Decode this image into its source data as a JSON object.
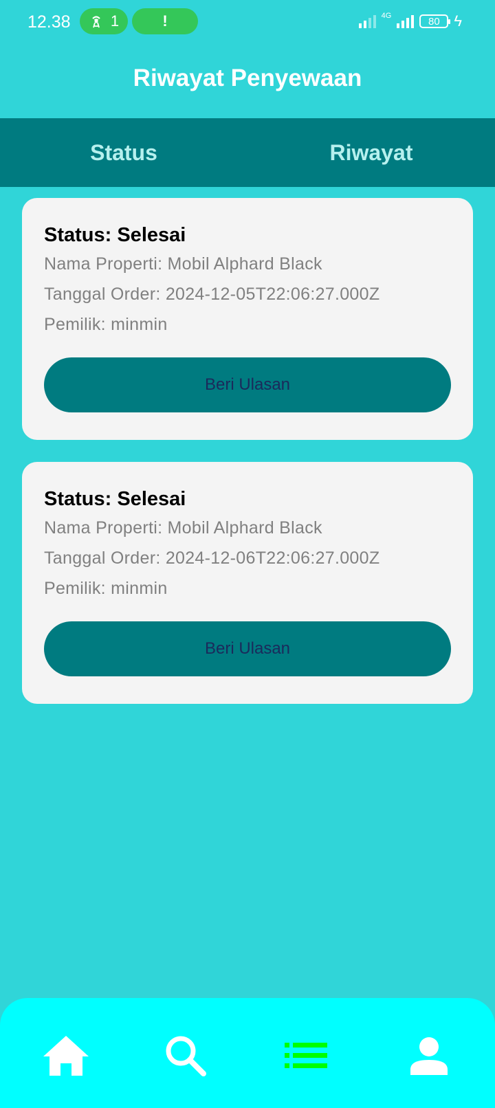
{
  "status_bar": {
    "time": "12.38",
    "hotspot_count": "1",
    "alert_symbol": "!",
    "network": "4G",
    "battery": "80"
  },
  "header": {
    "title": "Riwayat Penyewaan"
  },
  "tabs": [
    {
      "label": "Status"
    },
    {
      "label": "Riwayat"
    }
  ],
  "orders": [
    {
      "status": "Status: Selesai",
      "property": "Nama Properti: Mobil Alphard Black",
      "order_date": "Tanggal Order: 2024-12-05T22:06:27.000Z",
      "owner": "Pemilik: minmin",
      "button_label": "Beri Ulasan"
    },
    {
      "status": "Status: Selesai",
      "property": "Nama Properti: Mobil Alphard Black",
      "order_date": "Tanggal Order: 2024-12-06T22:06:27.000Z",
      "owner": "Pemilik: minmin",
      "button_label": "Beri Ulasan"
    }
  ],
  "bottom_nav": {
    "items": [
      {
        "icon": "home-icon",
        "active": false
      },
      {
        "icon": "search-icon",
        "active": false
      },
      {
        "icon": "list-icon",
        "active": true
      },
      {
        "icon": "person-icon",
        "active": false
      }
    ],
    "colors": {
      "default": "#ffffff",
      "active": "#00ff00",
      "background": "#00ffff"
    }
  },
  "colors": {
    "background": "#30d5d8",
    "tab_bar": "#007b80",
    "button": "#007b80",
    "card": "#f4f4f4"
  }
}
